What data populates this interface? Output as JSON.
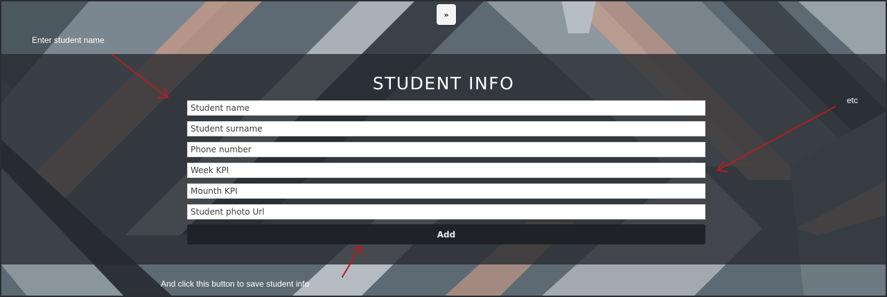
{
  "sidebar_toggle": {
    "label": "»"
  },
  "form": {
    "title": "STUDENT INFO",
    "fields": [
      {
        "placeholder": "Student name"
      },
      {
        "placeholder": "Student surname"
      },
      {
        "placeholder": "Phone number"
      },
      {
        "placeholder": "Week KPI"
      },
      {
        "placeholder": "Mounth KPI"
      },
      {
        "placeholder": "Student photo Url"
      }
    ],
    "submit_label": "Add"
  },
  "annotations": {
    "name_hint": "Enter student name",
    "etc_hint": "etc",
    "button_hint": "And click this button to save student info",
    "arrow_color": "#b01e22"
  },
  "colors": {
    "band": "#262a2f",
    "button": "#1f2227",
    "title": "#ffffff"
  }
}
